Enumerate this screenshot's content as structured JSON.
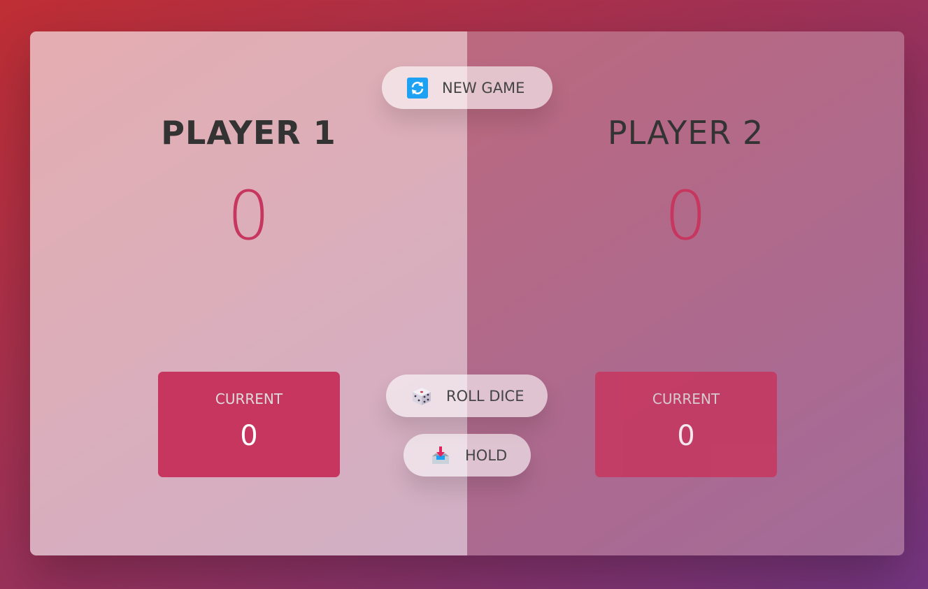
{
  "players": [
    {
      "name": "PLAYER 1",
      "score": "0",
      "current_label": "CURRENT",
      "current_score": "0",
      "active": true
    },
    {
      "name": "PLAYER 2",
      "score": "0",
      "current_label": "CURRENT",
      "current_score": "0",
      "active": false
    }
  ],
  "buttons": {
    "new_game": {
      "label": "NEW GAME",
      "icon": "refresh-icon"
    },
    "roll_dice": {
      "label": "ROLL DICE",
      "icon": "dice-icon"
    },
    "hold": {
      "label": "HOLD",
      "icon": "inbox-tray-icon"
    }
  },
  "colors": {
    "accent": "#c7365f",
    "icon_blue": "#1da1f2"
  }
}
